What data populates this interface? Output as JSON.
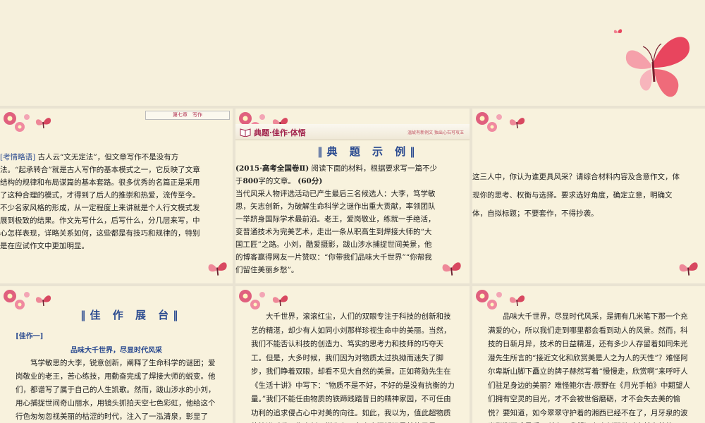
{
  "panel1": {
    "chapter": "第七章　写作",
    "tag": "[考情略语]",
    "intro": "古人云“文无定法”，但文章写作不是没有方法。“起承转合”就是古人写作的基本模式之一，它反映了文章结构的规律和布局谋篇的基本套路。很多优秀的名篇正是采用了这种合理的模式，才得到了后人的推崇和热爱，流传至今。不少名家风格的形成，从一定程度上来讲就是个人行文模式发展到极致的结果。作文先写什么，后写什么，分几层来写，中心怎样表现，详略关系如何，这些都是有技巧和规律的，特别是在应试作文中更加明显。"
  },
  "panel2": {
    "header_title": "典题·佳作·体悟",
    "header_motto": "温故有新例文  独出心石可攻玉",
    "section_title": "典 题 示 例",
    "source": "(2015·高考全国卷Ⅱ)",
    "prompt_a": "阅读下面的材料，根据要求写一篇不少于",
    "prompt_num": "800",
    "prompt_b": "字的文章。",
    "score": "(60分)",
    "material": "当代风采人物评选活动已产生最后三名候选人：大李，笃学敏思，矢志创新，为破解生命科学之谜作出重大贡献，率领团队一举跻身国际学术最前沿。老王，爱岗敬业，练就一手绝活，变普通技术为完美艺术，走出一条从职高生到焊接大师的“大国工匠”之路。小刘，酷爱摄影，跋山涉水捕捉世间美景，他的博客赢得网友一片赞叹：“你带我们品味大千世界”“你帮我们留住美丽乡愁”。"
  },
  "panel3": {
    "text": "这三人中，你认为谁更具风采？请综合材料内容及含意作文，体现你的思考、权衡与选择。要求选好角度，确定立意，明确文体，自拟标题；不要套作，不得抄袭。"
  },
  "panel4": {
    "section_title": "佳 作 展 台",
    "essay_tag": "[佳作一]",
    "essay_title": "品味大千世界，尽显时代风采",
    "text": "笃学敏思的大李，锐意创新，阐释了生命科学的谜团；爱岗敬业的老王，苦心练技，用勤奋完成了焊接大师的蜕变。他们，都谱写了属于自己的人生凯歌。然而，跋山涉水的小刘，用心捕捉世间奇山丽水，用镜头抓拍天空七色彩虹，他给这个行色匆匆忽视美丽的枯涩的时代，注入了一泓清泉，彰显了"
  },
  "panel5": {
    "text": "大千世界，滚滚红尘，人们的双眼专注于科技的创新和技艺的精湛，却少有人如同小刘那样珍视生命中的美丽。当然，我们不能否认科技的创造力、笃实的思考力和技师的巧夺天工。但是，大多时候，我们因为对物质太过执拗而迷失了脚步，我们睁着双眼，却看不见大自然的美景。正如蒋勋先生在《生活十讲》中写下：“物质不是不好，不好的是没有抗衡的力量。”我们不能任由物质的铁蹄践踏昔日的精神家园，不可任由功利的追求侵占心中对美的向往。如此，我以为，值此超物质的快进时代，像小刘一样肯在云台山青间捕捉最美的风景，"
  },
  "panel6": {
    "text": "品味大千世界，尽显时代风采，是拥有几米笔下那一个充满爱的心，所以我们走到哪里都会看到动人的风景。然而，科技的日新月异，技术的日益精湛，还有多少人存留着如同朱光潜先生所言的“接近文化和欣赏美是人之为人的天性”？难怪阿尔卑斯山脚下矗立的牌子赫然写着“慢慢走，欣赏啊”来呼吁人们驻足身边的美丽？难怪鲍尔吉·原野在《月光手帕》中期望人们拥有空灵的目光，才不会被世俗磨砺，才不会失去美的愉悦？要知道，如今翠翠守护着的湘西已经不在了，月牙泉的波光粼粼再难寻觅，所幸，我们还有小刘那份对自然之美的"
  }
}
